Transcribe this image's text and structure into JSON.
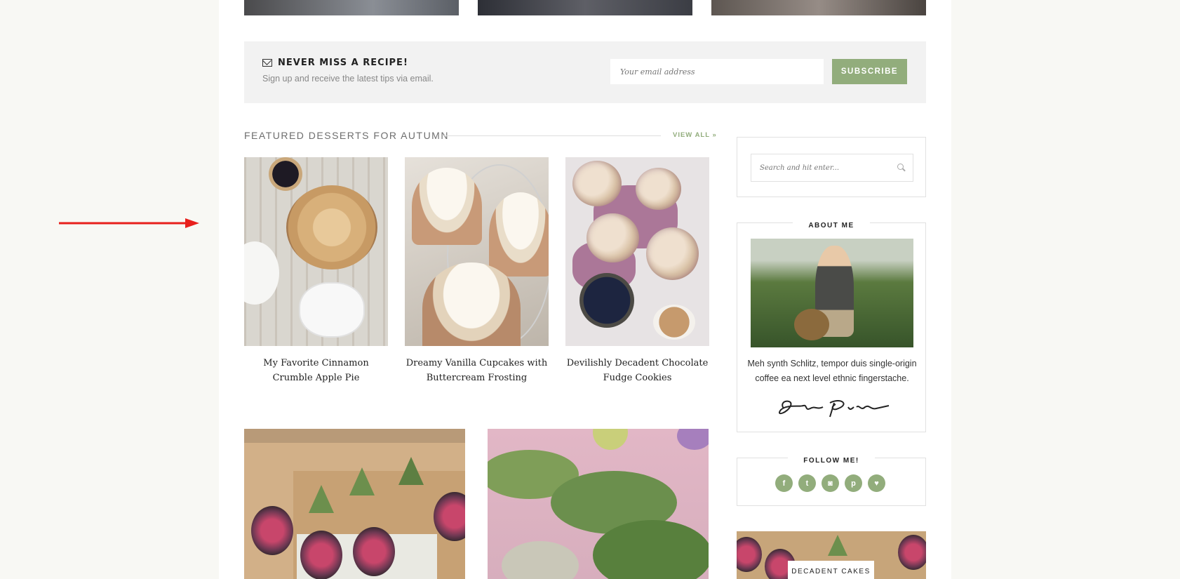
{
  "newsletter": {
    "title": "NEVER MISS A RECIPE!",
    "subtitle": "Sign up and receive the latest tips via email.",
    "email_placeholder": "Your email address",
    "subscribe_label": "SUBSCRIBE"
  },
  "featured": {
    "title": "FEATURED DESSERTS FOR AUTUMN",
    "view_all": "VIEW ALL »",
    "cards": [
      {
        "title": "My Favorite Cinnamon Crumble Apple Pie"
      },
      {
        "title": "Dreamy Vanilla Cupcakes with Buttercream Frosting"
      },
      {
        "title": "Devilishly Decadent Chocolate Fudge Cookies"
      }
    ]
  },
  "sidebar": {
    "search_placeholder": "Search and hit enter...",
    "about": {
      "title": "ABOUT ME",
      "text": "Meh synth Schlitz, tempor duis single-origin coffee ea next level ethnic fingerstache.",
      "signature": "Solo Pine"
    },
    "follow": {
      "title": "FOLLOW ME!",
      "icons": [
        "facebook-icon",
        "twitter-icon",
        "instagram-icon",
        "pinterest-icon",
        "heart-icon"
      ]
    },
    "promo": {
      "label": "DECADENT CAKES"
    }
  },
  "colors": {
    "accent": "#92ad7c",
    "annotation_arrow": "#e8201c"
  }
}
